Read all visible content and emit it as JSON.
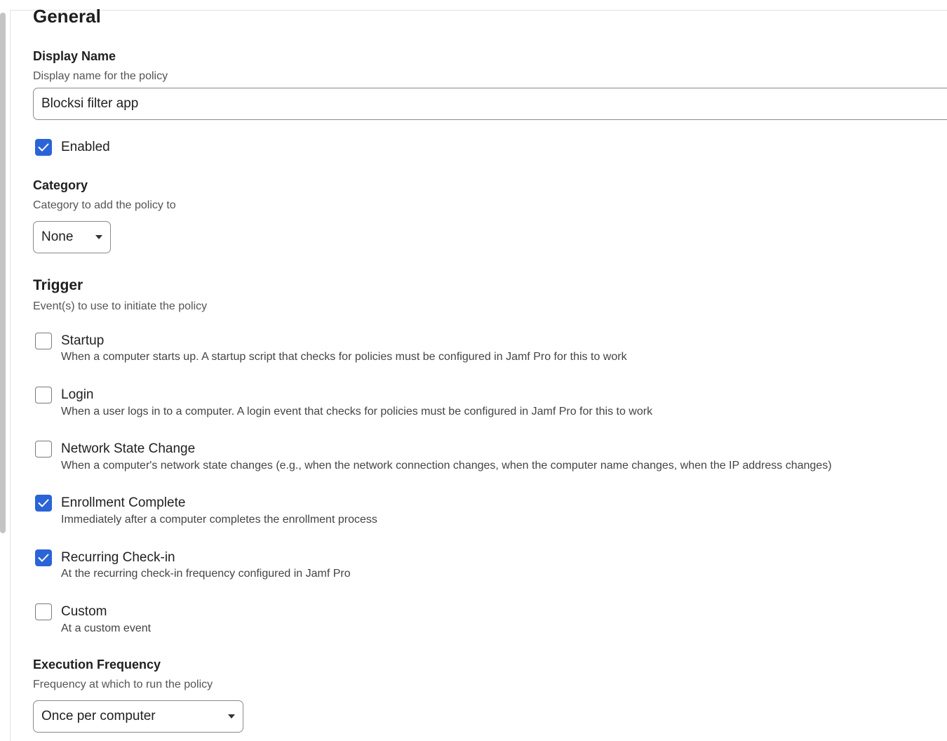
{
  "general": {
    "title": "General"
  },
  "display_name": {
    "label": "Display Name",
    "description": "Display name for the policy",
    "value": "Blocksi filter app"
  },
  "enabled": {
    "label": "Enabled",
    "checked": true
  },
  "category": {
    "label": "Category",
    "description": "Category to add the policy to",
    "selected": "None"
  },
  "trigger": {
    "label": "Trigger",
    "description": "Event(s) to use to initiate the policy",
    "options": [
      {
        "label": "Startup",
        "description": "When a computer starts up. A startup script that checks for policies must be configured in Jamf Pro for this to work",
        "checked": false
      },
      {
        "label": "Login",
        "description": "When a user logs in to a computer. A login event that checks for policies must be configured in Jamf Pro for this to work",
        "checked": false
      },
      {
        "label": "Network State Change",
        "description": "When a computer's network state changes (e.g., when the network connection changes, when the computer name changes, when the IP address changes)",
        "checked": false
      },
      {
        "label": "Enrollment Complete",
        "description": "Immediately after a computer completes the enrollment process",
        "checked": true
      },
      {
        "label": "Recurring Check-in",
        "description": "At the recurring check-in frequency configured in Jamf Pro",
        "checked": true
      },
      {
        "label": "Custom",
        "description": "At a custom event",
        "checked": false
      }
    ]
  },
  "execution_frequency": {
    "label": "Execution Frequency",
    "description": "Frequency at which to run the policy",
    "selected": "Once per computer"
  },
  "colors": {
    "accent": "#2a64d6"
  }
}
